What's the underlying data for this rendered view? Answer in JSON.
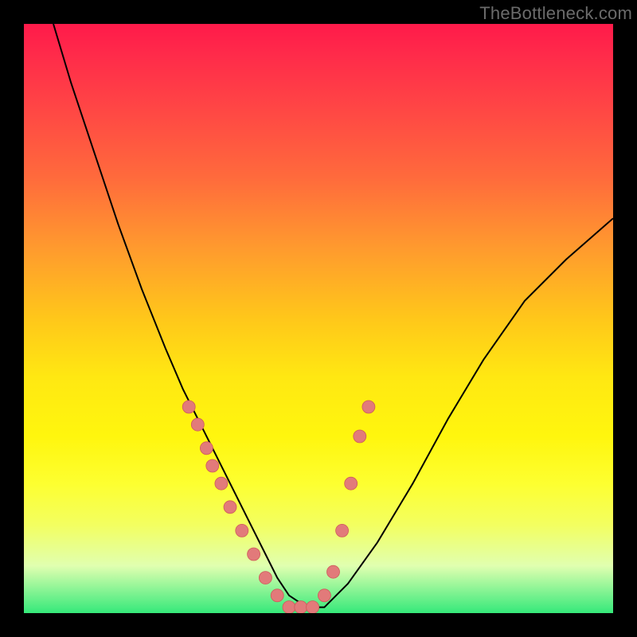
{
  "watermark": "TheBottleneck.com",
  "chart_data": {
    "type": "line",
    "title": "",
    "xlabel": "",
    "ylabel": "",
    "xlim": [
      0,
      100
    ],
    "ylim": [
      0,
      100
    ],
    "grid": false,
    "legend": false,
    "series": [
      {
        "name": "curve",
        "x": [
          5,
          8,
          12,
          16,
          20,
          24,
          27,
          30,
          33,
          35,
          37,
          39,
          41,
          43,
          45,
          48,
          51,
          55,
          60,
          66,
          72,
          78,
          85,
          92,
          100
        ],
        "y": [
          100,
          90,
          78,
          66,
          55,
          45,
          38,
          32,
          26,
          22,
          18,
          14,
          10,
          6,
          3,
          1,
          1,
          5,
          12,
          22,
          33,
          43,
          53,
          60,
          67
        ]
      }
    ],
    "markers": {
      "name": "highlight-dots",
      "color": "#e27a7a",
      "x": [
        28,
        29.5,
        31,
        32,
        33.5,
        35,
        37,
        39,
        41,
        43,
        45,
        47,
        49,
        51,
        52.5,
        54,
        55.5,
        57,
        58.5
      ],
      "y": [
        35,
        32,
        28,
        25,
        22,
        18,
        14,
        10,
        6,
        3,
        1,
        1,
        1,
        3,
        7,
        14,
        22,
        30,
        35
      ]
    },
    "background_gradient": {
      "top": "#ff1a4a",
      "mid": "#ffe812",
      "bottom": "#35e97a"
    }
  }
}
